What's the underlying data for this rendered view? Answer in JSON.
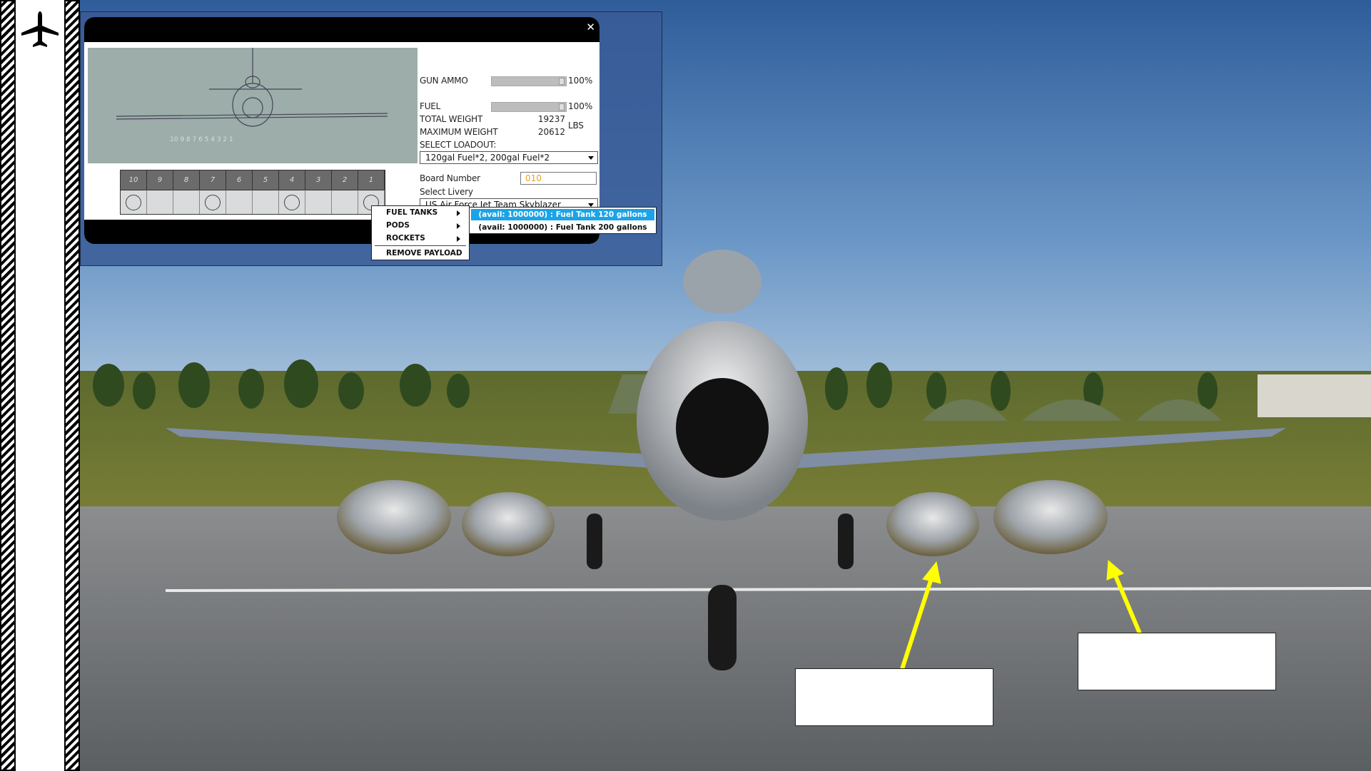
{
  "editor": {
    "close_glyph": "✕",
    "preview_station_labels": "10 9 8 7 6 5 4 3 2 1",
    "stations": [
      "10",
      "9",
      "8",
      "7",
      "6",
      "5",
      "4",
      "3",
      "2",
      "1"
    ],
    "gun_ammo": {
      "label": "GUN AMMO",
      "value": "100%",
      "level": 1.0
    },
    "fuel": {
      "label": "FUEL",
      "value": "100%",
      "level": 1.0
    },
    "total_weight": {
      "label": "TOTAL WEIGHT",
      "value": "19237"
    },
    "maximum_weight": {
      "label": "MAXIMUM WEIGHT",
      "value": "20612"
    },
    "weight_unit": "LBS",
    "select_loadout": {
      "label": "SELECT LOADOUT:",
      "value": "120gal Fuel*2, 200gal Fuel*2"
    },
    "board_number": {
      "label": "Board Number",
      "value": "010"
    },
    "select_livery": {
      "label": "Select Livery",
      "value": "US Air Force Jet Team Skyblazer"
    }
  },
  "context_menu": {
    "items": [
      "FUEL TANKS",
      "PODS",
      "ROCKETS"
    ],
    "remove": "REMOVE PAYLOAD"
  },
  "submenu": {
    "items": [
      "(avail: 1000000) : Fuel Tank 120 gallons",
      "(avail: 1000000) : Fuel Tank 200 gallons"
    ],
    "highlighted_index": 0,
    "highlight_color": "#1aa3e8"
  },
  "callouts": {
    "arrow_color": "#ffff00"
  }
}
